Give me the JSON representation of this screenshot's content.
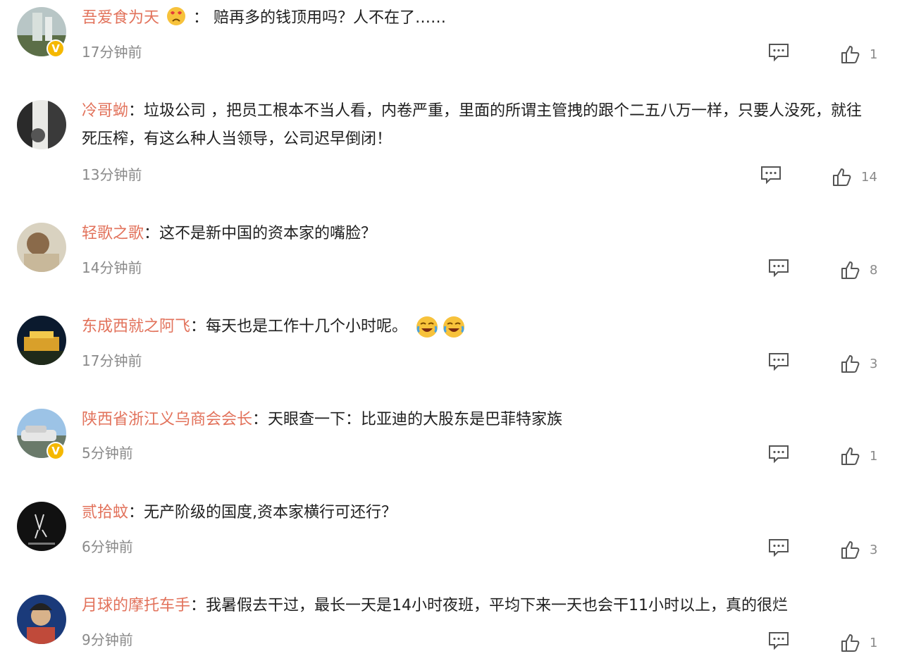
{
  "comments": [
    {
      "username": "吾爱食为天",
      "separator": "：",
      "text": "赔再多的钱顶用吗？人不在了……",
      "time": "17分钟前",
      "likes": "1",
      "emoji_inline": "crying-heart-face-icon"
    },
    {
      "username": "冷哥蚴",
      "separator": "：",
      "text": "垃圾公司 ，把员工根本不当人看，内卷严重，里面的所谓主管拽的跟个二五八万一样，只要人没死，就往死压榨，有这么种人当领导，公司迟早倒闭！",
      "time": "13分钟前",
      "likes": "14"
    },
    {
      "username": "轻歌之歌",
      "separator": "：",
      "text": "这不是新中国的资本家的嘴脸？",
      "time": "14分钟前",
      "likes": "8"
    },
    {
      "username": "东成西就之阿飞",
      "separator": "：",
      "text": "每天也是工作十几个小时呢。",
      "time": "17分钟前",
      "likes": "3",
      "emoji_trailing": [
        "laugh-cry-icon",
        "laugh-cry-icon"
      ]
    },
    {
      "username": "陕西省浙江义乌商会会长",
      "separator": "：",
      "text": "天眼查一下：比亚迪的大股东是巴菲特家族",
      "time": "5分钟前",
      "likes": "1"
    },
    {
      "username": "贰拾蚊",
      "separator": "：",
      "text": "无产阶级的国度,资本家横行可还行？",
      "time": "6分钟前",
      "likes": "3"
    },
    {
      "username": "月球的摩托车手",
      "separator": "：",
      "text": "我暑假去干过，最长一天是14小时夜班，平均下来一天也会干11小时以上，真的很烂",
      "time": "9分钟前",
      "likes": "1"
    }
  ],
  "colors": {
    "username": "#e2725b",
    "meta": "#8a8a8a",
    "badge": "#f5b800"
  }
}
